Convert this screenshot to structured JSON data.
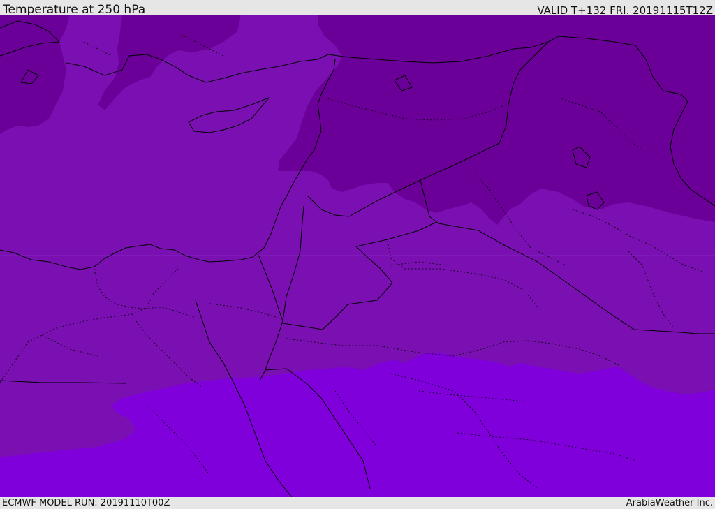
{
  "header": {
    "title": "Temperature at 250 hPa",
    "valid": "VALID T+132 FRI. 20191115T12Z"
  },
  "footer": {
    "model_run": "ECMWF MODEL RUN: 20191110T00Z",
    "credit": "ArabiaWeather Inc."
  },
  "colors": {
    "background": "#e6e6e6",
    "band_dark": "#6b0098",
    "band_mid": "#7a10b2",
    "band_light": "#8000dc",
    "borders": "#000000"
  }
}
